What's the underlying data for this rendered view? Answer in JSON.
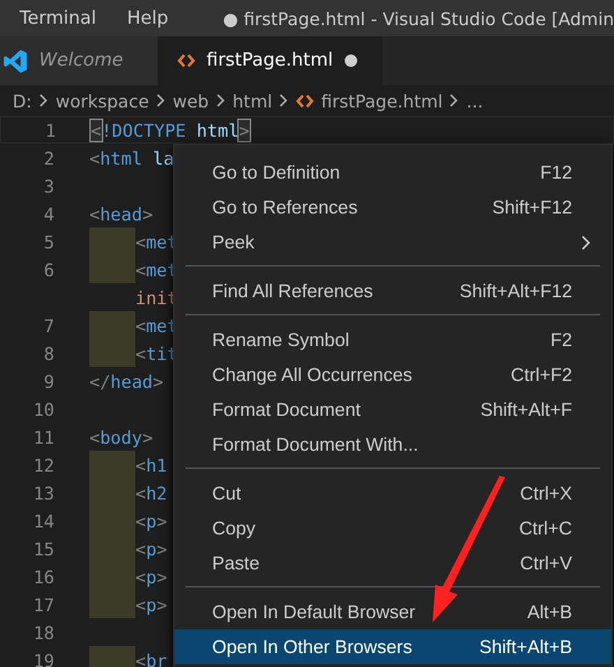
{
  "menu_bar": [
    {
      "label": "Terminal"
    },
    {
      "label": "Help"
    }
  ],
  "window": {
    "title": "● firstPage.html - Visual Studio Code [Admin"
  },
  "tabs": [
    {
      "label": "Welcome",
      "kind": "welcome",
      "selected": false,
      "dirty": false
    },
    {
      "label": "firstPage.html",
      "kind": "html",
      "selected": true,
      "dirty": true
    }
  ],
  "breadcrumb": [
    {
      "label": "D:",
      "kind": "folder"
    },
    {
      "label": "workspace",
      "kind": "folder"
    },
    {
      "label": "web",
      "kind": "folder"
    },
    {
      "label": "html",
      "kind": "folder"
    },
    {
      "label": "firstPage.html",
      "kind": "html"
    },
    {
      "label": "...",
      "kind": "more"
    }
  ],
  "editor": {
    "lines": [
      {
        "number": "1",
        "current": true,
        "guide": false,
        "indent": false,
        "tokens": [
          {
            "text": "<",
            "kind": "bracket-match"
          },
          {
            "text": "!DOCTYPE",
            "kind": "tag"
          },
          {
            "text": " html",
            "kind": "attr"
          },
          {
            "text": ">",
            "kind": "bracket-match"
          }
        ]
      },
      {
        "number": "2",
        "current": false,
        "guide": false,
        "indent": false,
        "tokens": [
          {
            "text": "<",
            "kind": "punct"
          },
          {
            "text": "html",
            "kind": "tag"
          },
          {
            "text": " la",
            "kind": "attr"
          }
        ]
      },
      {
        "number": "3",
        "current": false,
        "guide": false
      },
      {
        "number": "4",
        "current": false,
        "guide": false,
        "indent": false,
        "tokens": [
          {
            "text": "<",
            "kind": "punct"
          },
          {
            "text": "head",
            "kind": "tag"
          },
          {
            "text": ">",
            "kind": "punct"
          }
        ]
      },
      {
        "number": "5",
        "current": false,
        "guide": true,
        "indent": true,
        "tokens": [
          {
            "text": "<",
            "kind": "punct"
          },
          {
            "text": "met",
            "kind": "tag"
          }
        ]
      },
      {
        "number": "6",
        "current": false,
        "guide": true,
        "indent": true,
        "tokens": [
          {
            "text": "<",
            "kind": "punct"
          },
          {
            "text": "met",
            "kind": "tag"
          }
        ]
      },
      {
        "current": false,
        "guide": false,
        "indent": true,
        "tokens": [
          {
            "text": "init",
            "kind": "string"
          }
        ]
      },
      {
        "number": "7",
        "current": false,
        "guide": true,
        "indent": true,
        "tokens": [
          {
            "text": "<",
            "kind": "punct"
          },
          {
            "text": "met",
            "kind": "tag"
          }
        ]
      },
      {
        "number": "8",
        "current": false,
        "guide": true,
        "indent": true,
        "tokens": [
          {
            "text": "<",
            "kind": "punct"
          },
          {
            "text": "tit",
            "kind": "tag"
          }
        ]
      },
      {
        "number": "9",
        "current": false,
        "guide": false,
        "indent": false,
        "tokens": [
          {
            "text": "</",
            "kind": "punct"
          },
          {
            "text": "head",
            "kind": "tag"
          },
          {
            "text": ">",
            "kind": "punct"
          }
        ]
      },
      {
        "number": "10",
        "current": false,
        "guide": false
      },
      {
        "number": "11",
        "current": false,
        "guide": false,
        "indent": false,
        "tokens": [
          {
            "text": "<",
            "kind": "punct"
          },
          {
            "text": "body",
            "kind": "tag"
          },
          {
            "text": ">",
            "kind": "punct"
          }
        ]
      },
      {
        "number": "12",
        "current": false,
        "guide": true,
        "indent": true,
        "tokens": [
          {
            "text": "<",
            "kind": "punct"
          },
          {
            "text": "h1",
            "kind": "tag"
          }
        ]
      },
      {
        "number": "13",
        "current": false,
        "guide": true,
        "indent": true,
        "tokens": [
          {
            "text": "<",
            "kind": "punct"
          },
          {
            "text": "h2",
            "kind": "tag"
          }
        ]
      },
      {
        "number": "14",
        "current": false,
        "guide": true,
        "indent": true,
        "tokens": [
          {
            "text": "<",
            "kind": "punct"
          },
          {
            "text": "p",
            "kind": "tag"
          },
          {
            "text": ">",
            "kind": "punct"
          }
        ]
      },
      {
        "number": "15",
        "current": false,
        "guide": true,
        "indent": true,
        "tokens": [
          {
            "text": "<",
            "kind": "punct"
          },
          {
            "text": "p",
            "kind": "tag"
          },
          {
            "text": ">",
            "kind": "punct"
          }
        ]
      },
      {
        "number": "16",
        "current": false,
        "guide": true,
        "indent": true,
        "tokens": [
          {
            "text": "<",
            "kind": "punct"
          },
          {
            "text": "p",
            "kind": "tag"
          },
          {
            "text": ">",
            "kind": "punct"
          }
        ]
      },
      {
        "number": "17",
        "current": false,
        "guide": true,
        "indent": true,
        "tokens": [
          {
            "text": "<",
            "kind": "punct"
          },
          {
            "text": "p",
            "kind": "tag"
          },
          {
            "text": ">",
            "kind": "punct"
          }
        ]
      },
      {
        "number": "18",
        "current": false,
        "guide": false
      },
      {
        "number": "19",
        "current": false,
        "guide": true,
        "indent": true,
        "tokens": [
          {
            "text": "<",
            "kind": "punct"
          },
          {
            "text": "br",
            "kind": "tag"
          }
        ]
      }
    ]
  },
  "context_menu": {
    "groups": [
      [
        {
          "label": "Go to Definition",
          "shortcut": "F12",
          "submenu": false,
          "selected": false
        },
        {
          "label": "Go to References",
          "shortcut": "Shift+F12",
          "submenu": false,
          "selected": false
        },
        {
          "label": "Peek",
          "submenu": true,
          "selected": false
        }
      ],
      [
        {
          "label": "Find All References",
          "shortcut": "Shift+Alt+F12",
          "submenu": false,
          "selected": false
        }
      ],
      [
        {
          "label": "Rename Symbol",
          "shortcut": "F2",
          "submenu": false,
          "selected": false
        },
        {
          "label": "Change All Occurrences",
          "shortcut": "Ctrl+F2",
          "submenu": false,
          "selected": false
        },
        {
          "label": "Format Document",
          "shortcut": "Shift+Alt+F",
          "submenu": false,
          "selected": false
        },
        {
          "label": "Format Document With...",
          "submenu": false,
          "selected": false
        }
      ],
      [
        {
          "label": "Cut",
          "shortcut": "Ctrl+X",
          "submenu": false,
          "selected": false
        },
        {
          "label": "Copy",
          "shortcut": "Ctrl+C",
          "submenu": false,
          "selected": false
        },
        {
          "label": "Paste",
          "shortcut": "Ctrl+V",
          "submenu": false,
          "selected": false
        }
      ],
      [
        {
          "label": "Open In Default Browser",
          "shortcut": "Alt+B",
          "submenu": false,
          "selected": false
        },
        {
          "label": "Open In Other Browsers",
          "shortcut": "Shift+Alt+B",
          "submenu": false,
          "selected": true
        }
      ]
    ]
  }
}
